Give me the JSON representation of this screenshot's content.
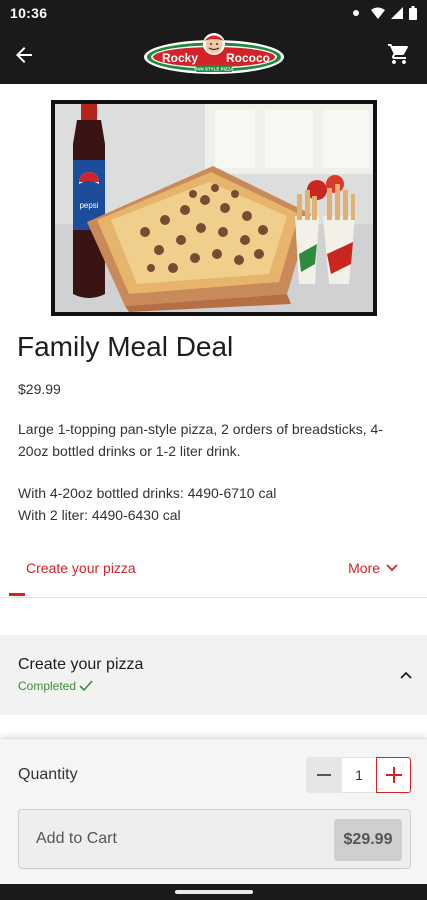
{
  "status_bar": {
    "time": "10:36",
    "icons": [
      "notification-dot-icon",
      "wifi-icon",
      "cellular-icon",
      "battery-icon"
    ]
  },
  "header": {
    "back_icon": "arrow-left-icon",
    "logo_text": "Rocky Rococo",
    "logo_tagline": "PAN STYLE PIZZA",
    "cart_icon": "shopping-cart-icon",
    "background": "#1a1a1a"
  },
  "product": {
    "image_text": "pepsi",
    "title": "Family Meal Deal",
    "price": "$29.99",
    "description": "Large 1-topping pan-style pizza, 2 orders of breadsticks, 4-20oz bottled drinks or 1-2 liter drink.",
    "calories_line1": "With 4-20oz bottled drinks: 4490-6710 cal",
    "calories_line2": "With 2 liter: 4490-6430 cal"
  },
  "tabs": {
    "active": "Create your pizza",
    "more": "More",
    "more_icon": "chevron-down-icon",
    "accent": "#d2232a"
  },
  "section": {
    "title": "Create your pizza",
    "status": "Completed",
    "status_icon": "checkmark-icon",
    "chevron_icon": "chevron-up-icon",
    "status_color": "#3d8b3d"
  },
  "order": {
    "quantity_label": "Quantity",
    "quantity": "1",
    "minus_icon": "minus-icon",
    "plus_icon": "plus-icon",
    "add_to_cart": "Add to Cart",
    "total": "$29.99"
  }
}
